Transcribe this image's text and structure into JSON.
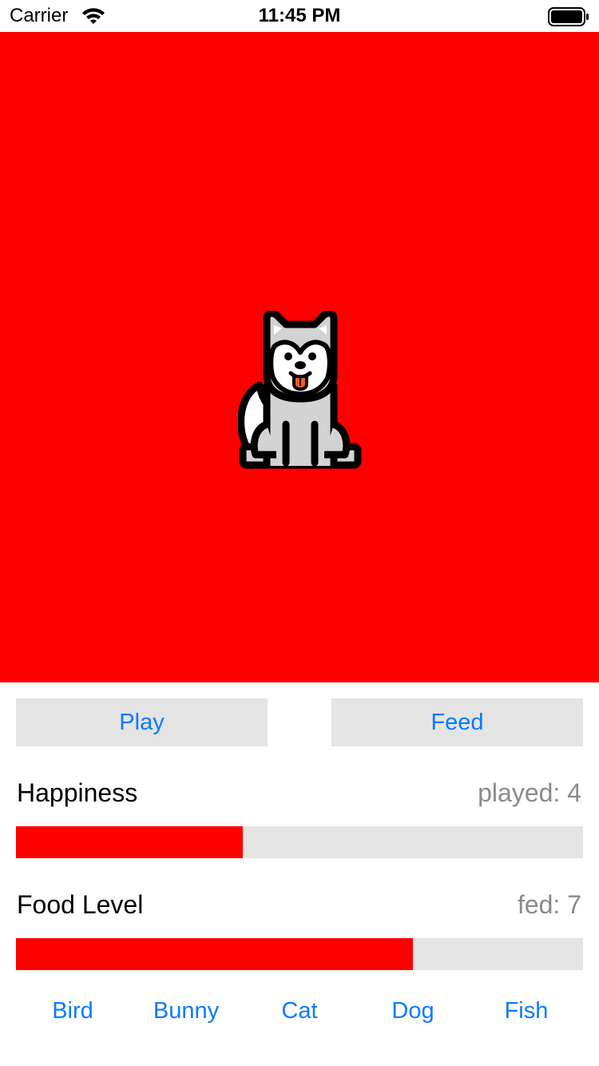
{
  "status_bar": {
    "carrier": "Carrier",
    "time": "11:45 PM",
    "icons": [
      "wifi-icon",
      "battery-icon"
    ]
  },
  "pet": {
    "current": "Dog",
    "icon": "husky-dog-icon",
    "background_color": "#ff0000"
  },
  "actions": {
    "play_label": "Play",
    "feed_label": "Feed"
  },
  "stats": {
    "happiness": {
      "label": "Happiness",
      "count_text": "played: 4",
      "level": 0.4
    },
    "food": {
      "label": "Food Level",
      "count_text": "fed: 7",
      "level": 0.7
    }
  },
  "pet_selector": [
    "Bird",
    "Bunny",
    "Cat",
    "Dog",
    "Fish"
  ],
  "colors": {
    "accent": "#0a7aff",
    "progress_fill": "#ff0000",
    "progress_track": "#e4e4e4",
    "button_bg": "#e4e4e4",
    "secondary_text": "#8a8a8a"
  }
}
